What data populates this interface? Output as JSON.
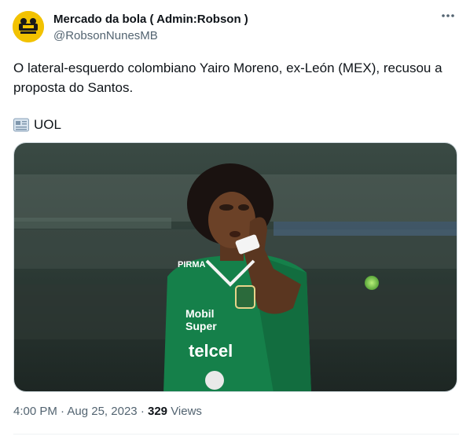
{
  "tweet": {
    "author_name": "Mercado da bola ( Admin:Robson )",
    "author_handle": "@RobsonNunesMB",
    "text": "O lateral-esquerdo colombiano Yairo Moreno, ex-León (MEX), recusou a proposta do Santos.",
    "source_icon": "newspaper-icon",
    "source_label": "UOL",
    "time": "4:00 PM",
    "date": "Aug 25, 2023",
    "separator": "·",
    "views_count": "329",
    "views_label": "Views"
  },
  "photo": {
    "jersey_sponsor_1": "Mobil",
    "jersey_sponsor_1b": "Super",
    "jersey_sponsor_2": "telcel",
    "jersey_brand": "PIRMA",
    "jersey_color": "#15804a"
  },
  "colors": {
    "text_primary": "#0f1419",
    "text_secondary": "#536471",
    "avatar_bg": "#f2c200"
  }
}
